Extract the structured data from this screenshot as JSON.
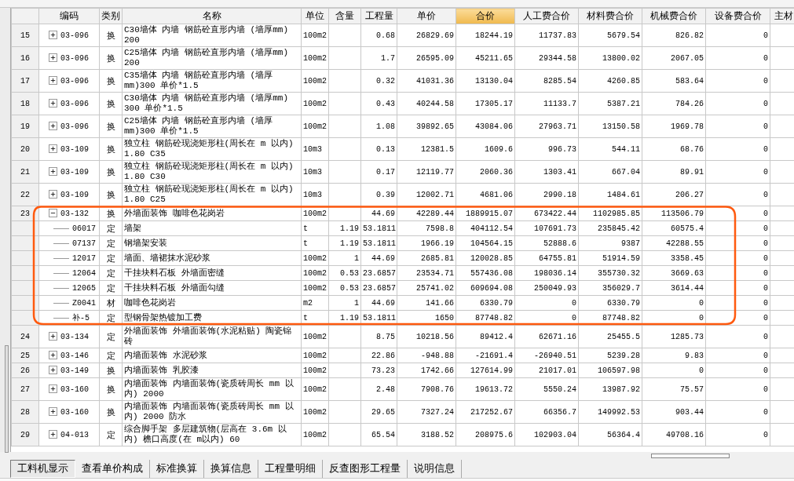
{
  "columns": [
    {
      "selected": false
    },
    {
      "label": "编码",
      "selected": false
    },
    {
      "label": "类别",
      "selected": false
    },
    {
      "label": "名称",
      "selected": false
    },
    {
      "label": "单位",
      "selected": false
    },
    {
      "label": "含量",
      "selected": false
    },
    {
      "label": "工程量",
      "selected": false
    },
    {
      "label": "单价",
      "selected": false
    },
    {
      "label": "合价",
      "selected": true
    },
    {
      "label": "人工费合价",
      "selected": false
    },
    {
      "label": "材料费合价",
      "selected": false
    },
    {
      "label": "机械费合价",
      "selected": false
    },
    {
      "label": "设备费合价",
      "selected": false
    },
    {
      "label": "主材",
      "selected": false
    }
  ],
  "rows": [
    {
      "number": "15",
      "kind": "parent",
      "expanded": false,
      "code": "03-096",
      "type": "换",
      "name": "C30墙体 内墙 钢筋砼直形内墙 (墙厚mm) 200",
      "unit": "100m2",
      "content": "",
      "quantity": "0.68",
      "unit_price": "26829.69",
      "total": "18244.19",
      "labor": "11737.83",
      "material": "5679.54",
      "machine": "826.82",
      "equipment": "0"
    },
    {
      "number": "16",
      "kind": "parent",
      "expanded": false,
      "code": "03-096",
      "type": "换",
      "name": "C25墙体 内墙 钢筋砼直形内墙 (墙厚mm) 200",
      "unit": "100m2",
      "content": "",
      "quantity": "1.7",
      "unit_price": "26595.09",
      "total": "45211.65",
      "labor": "29344.58",
      "material": "13800.02",
      "machine": "2067.05",
      "equipment": "0"
    },
    {
      "number": "17",
      "kind": "parent",
      "expanded": false,
      "code": "03-096",
      "type": "换",
      "name": "C35墙体 内墙 钢筋砼直形内墙 (墙厚mm)300 单价*1.5",
      "unit": "100m2",
      "content": "",
      "quantity": "0.32",
      "unit_price": "41031.36",
      "total": "13130.04",
      "labor": "8285.54",
      "material": "4260.85",
      "machine": "583.64",
      "equipment": "0"
    },
    {
      "number": "18",
      "kind": "parent",
      "expanded": false,
      "code": "03-096",
      "type": "换",
      "name": "C30墙体 内墙 钢筋砼直形内墙 (墙厚mm) 300  单价*1.5",
      "unit": "100m2",
      "content": "",
      "quantity": "0.43",
      "unit_price": "40244.58",
      "total": "17305.17",
      "labor": "11133.7",
      "material": "5387.21",
      "machine": "784.26",
      "equipment": "0"
    },
    {
      "number": "19",
      "kind": "parent",
      "expanded": false,
      "code": "03-096",
      "type": "换",
      "name": "C25墙体 内墙 钢筋砼直形内墙 (墙厚mm)300  单价*1.5",
      "unit": "100m2",
      "content": "",
      "quantity": "1.08",
      "unit_price": "39892.65",
      "total": "43084.06",
      "labor": "27963.71",
      "material": "13150.58",
      "machine": "1969.78",
      "equipment": "0"
    },
    {
      "number": "20",
      "kind": "parent",
      "expanded": false,
      "code": "03-109",
      "type": "换",
      "name": "独立柱 钢筋砼现浇矩形柱(周长在 m 以内) 1.80 C35",
      "unit": "10m3",
      "content": "",
      "quantity": "0.13",
      "unit_price": "12381.5",
      "total": "1609.6",
      "labor": "996.73",
      "material": "544.11",
      "machine": "68.76",
      "equipment": "0"
    },
    {
      "number": "21",
      "kind": "parent",
      "expanded": false,
      "code": "03-109",
      "type": "换",
      "name": "独立柱 钢筋砼现浇矩形柱(周长在 m 以内) 1.80 C30",
      "unit": "10m3",
      "content": "",
      "quantity": "0.17",
      "unit_price": "12119.77",
      "total": "2060.36",
      "labor": "1303.41",
      "material": "667.04",
      "machine": "89.91",
      "equipment": "0"
    },
    {
      "number": "22",
      "kind": "parent",
      "expanded": false,
      "code": "03-109",
      "type": "换",
      "name": "独立柱 钢筋砼现浇矩形柱(周长在 m 以内) 1.80 C25",
      "unit": "10m3",
      "content": "",
      "quantity": "0.39",
      "unit_price": "12002.71",
      "total": "4681.06",
      "labor": "2990.18",
      "material": "1484.61",
      "machine": "206.27",
      "equipment": "0"
    },
    {
      "number": "23",
      "kind": "parent",
      "expanded": true,
      "code": "03-132",
      "type": "换",
      "name": "外墙面装饰 咖啡色花岗岩",
      "unit": "100m2",
      "content": "",
      "quantity": "44.69",
      "unit_price": "42289.44",
      "total": "1889915.07",
      "labor": "673422.44",
      "material": "1102985.85",
      "machine": "113506.79",
      "equipment": "0"
    },
    {
      "number": "",
      "kind": "child",
      "code": "06017",
      "type": "定",
      "name": "墙架",
      "unit": "t",
      "content": "1.19",
      "quantity": "53.1811",
      "unit_price": "7598.8",
      "total": "404112.54",
      "labor": "107691.73",
      "material": "235845.42",
      "machine": "60575.4",
      "equipment": "0"
    },
    {
      "number": "",
      "kind": "child",
      "code": "07137",
      "type": "定",
      "name": "钢墙架安装",
      "unit": "t",
      "content": "1.19",
      "quantity": "53.1811",
      "unit_price": "1966.19",
      "total": "104564.15",
      "labor": "52888.6",
      "material": "9387",
      "machine": "42288.55",
      "equipment": "0"
    },
    {
      "number": "",
      "kind": "child",
      "code": "12017",
      "type": "定",
      "name": "墙面、墙裙抹水泥砂浆",
      "unit": "100m2",
      "content": "1",
      "quantity": "44.69",
      "unit_price": "2685.81",
      "total": "120028.85",
      "labor": "64755.81",
      "material": "51914.59",
      "machine": "3358.45",
      "equipment": "0"
    },
    {
      "number": "",
      "kind": "child",
      "code": "12064",
      "type": "定",
      "name": "干挂块料石板 外墙面密缝",
      "unit": "100m2",
      "content": "0.53",
      "quantity": "23.6857",
      "unit_price": "23534.71",
      "total": "557436.08",
      "labor": "198036.14",
      "material": "355730.32",
      "machine": "3669.63",
      "equipment": "0"
    },
    {
      "number": "",
      "kind": "child",
      "code": "12065",
      "type": "定",
      "name": "干挂块料石板 外墙面勾缝",
      "unit": "100m2",
      "content": "0.53",
      "quantity": "23.6857",
      "unit_price": "25741.02",
      "total": "609694.08",
      "labor": "250049.93",
      "material": "356029.7",
      "machine": "3614.44",
      "equipment": "0"
    },
    {
      "number": "",
      "kind": "child",
      "code": "Z0041",
      "type": "材",
      "name": "咖啡色花岗岩",
      "unit": "m2",
      "content": "1",
      "quantity": "44.69",
      "unit_price": "141.66",
      "total": "6330.79",
      "labor": "0",
      "material": "6330.79",
      "machine": "0",
      "equipment": "0"
    },
    {
      "number": "",
      "kind": "child",
      "code": "补-5",
      "type": "定",
      "name": "型钢骨架热镀加工费",
      "unit": "t",
      "content": "1.19",
      "quantity": "53.1811",
      "unit_price": "1650",
      "total": "87748.82",
      "labor": "0",
      "material": "87748.82",
      "machine": "0",
      "equipment": "0"
    },
    {
      "number": "24",
      "kind": "parent",
      "expanded": false,
      "code": "03-134",
      "type": "定",
      "name": "外墙面装饰 外墙面装饰(水泥粘贴) 陶瓷锦砖",
      "unit": "100m2",
      "content": "",
      "quantity": "8.75",
      "unit_price": "10218.56",
      "total": "89412.4",
      "labor": "62671.16",
      "material": "25455.5",
      "machine": "1285.73",
      "equipment": "0"
    },
    {
      "number": "25",
      "kind": "parent",
      "expanded": false,
      "code": "03-146",
      "type": "定",
      "name": "内墙面装饰 水泥砂浆",
      "unit": "100m2",
      "content": "",
      "quantity": "22.86",
      "unit_price": "-948.88",
      "total": "-21691.4",
      "labor": "-26940.51",
      "material": "5239.28",
      "machine": "9.83",
      "equipment": "0"
    },
    {
      "number": "26",
      "kind": "parent",
      "expanded": false,
      "code": "03-149",
      "type": "换",
      "name": "内墙面装饰 乳胶漆",
      "unit": "100m2",
      "content": "",
      "quantity": "73.23",
      "unit_price": "1742.66",
      "total": "127614.99",
      "labor": "21017.01",
      "material": "106597.98",
      "machine": "0",
      "equipment": "0"
    },
    {
      "number": "27",
      "kind": "parent",
      "expanded": false,
      "code": "03-160",
      "type": "换",
      "name": "内墙面装饰 内墙面装饰(瓷质砖周长 mm 以内) 2000",
      "unit": "100m2",
      "content": "",
      "quantity": "2.48",
      "unit_price": "7908.76",
      "total": "19613.72",
      "labor": "5550.24",
      "material": "13987.92",
      "machine": "75.57",
      "equipment": "0"
    },
    {
      "number": "28",
      "kind": "parent",
      "expanded": false,
      "code": "03-160",
      "type": "换",
      "name": "内墙面装饰 内墙面装饰(瓷质砖周长 mm 以内) 2000 防水",
      "unit": "100m2",
      "content": "",
      "quantity": "29.65",
      "unit_price": "7327.24",
      "total": "217252.67",
      "labor": "66356.7",
      "material": "149992.53",
      "machine": "903.44",
      "equipment": "0"
    },
    {
      "number": "29",
      "kind": "parent",
      "expanded": false,
      "code": "04-013",
      "type": "定",
      "name": "综合脚手架 多层建筑物(层高在 3.6m 以内) 檐口高度(在 m以内) 60",
      "unit": "100m2",
      "content": "",
      "quantity": "65.54",
      "unit_price": "3188.52",
      "total": "208975.6",
      "labor": "102903.04",
      "material": "56364.4",
      "machine": "49708.16",
      "equipment": "0"
    }
  ],
  "bottom_tabs": [
    {
      "label": "工料机显示",
      "selected": true
    },
    {
      "label": "查看单价构成",
      "selected": false
    },
    {
      "label": "标准换算",
      "selected": false
    },
    {
      "label": "换算信息",
      "selected": false
    },
    {
      "label": "工程量明细",
      "selected": false
    },
    {
      "label": "反查图形工程量",
      "selected": false
    },
    {
      "label": "说明信息",
      "selected": false
    }
  ]
}
